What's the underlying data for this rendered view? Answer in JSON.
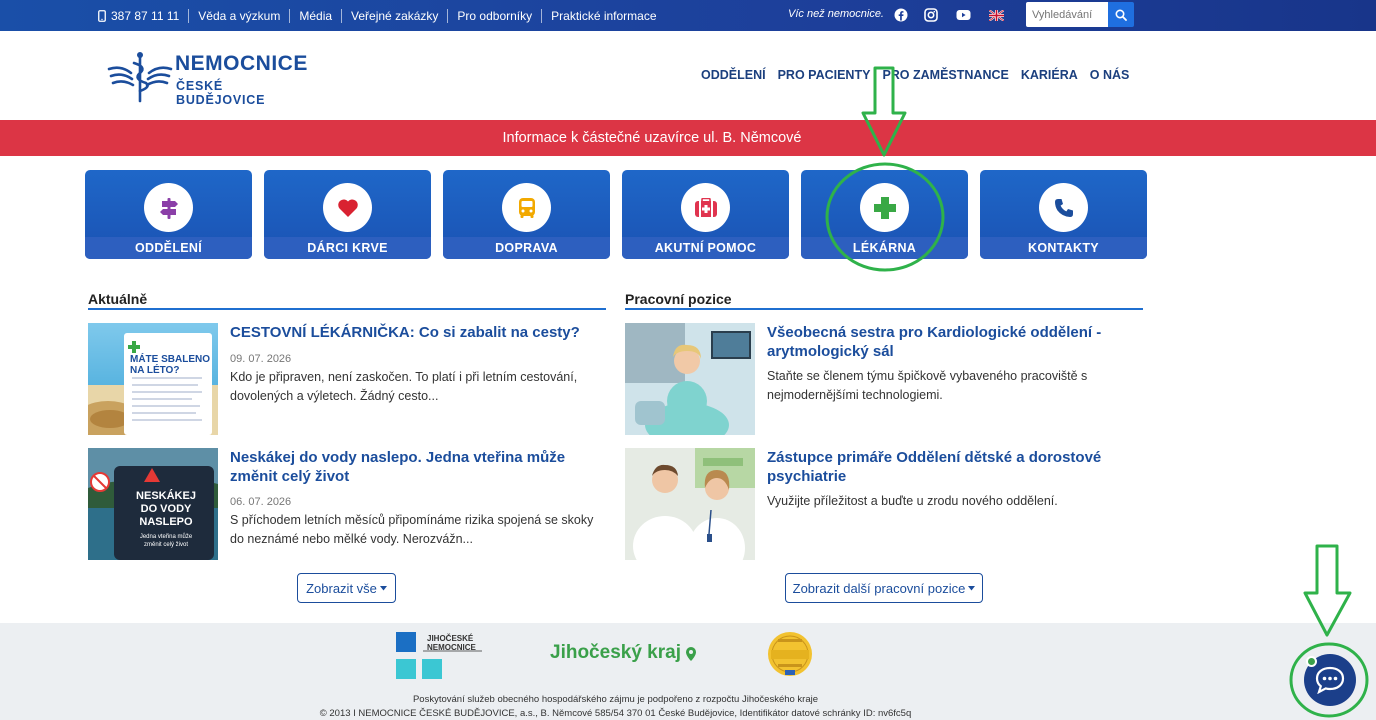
{
  "topbar": {
    "phone": "387 87 11 11",
    "links": [
      "Věda a výzkum",
      "Média",
      "Veřejné zakázky",
      "Pro odborníky",
      "Praktické informace"
    ],
    "tagline": "Víc než nemocnice.",
    "search_placeholder": "Vyhledávání"
  },
  "logo": {
    "line1": "NEMOCNICE",
    "line2": "ČESKÉ BUDĚJOVICE"
  },
  "nav": [
    "ODDĚLENÍ",
    "PRO PACIENTY",
    "PRO ZAMĚSTNANCE",
    "KARIÉRA",
    "O NÁS"
  ],
  "banner": "Informace k částečné uzavírce ul. B. Němcové",
  "tiles": [
    {
      "label": "ODDĚLENÍ",
      "icon": "signpost-icon",
      "color": "#8b3fa8"
    },
    {
      "label": "DÁRCI KRVE",
      "icon": "heart-icon",
      "color": "#d92231"
    },
    {
      "label": "DOPRAVA",
      "icon": "bus-icon",
      "color": "#f2a900"
    },
    {
      "label": "AKUTNÍ POMOC",
      "icon": "first-aid-icon",
      "color": "#e0344f"
    },
    {
      "label": "LÉKÁRNA",
      "icon": "pharmacy-cross-icon",
      "color": "#39a845"
    },
    {
      "label": "KONTAKTY",
      "icon": "phone-icon",
      "color": "#1b4d9c"
    }
  ],
  "news": {
    "title": "Aktuálně",
    "items": [
      {
        "title": "CESTOVNÍ LÉKÁRNIČKA: Co si zabalit na cesty?",
        "date": "09. 07. 2026",
        "text": "Kdo je připraven, není zaskočen. To platí i při letním cestování, dovolených a výletech. Žádný cesto...",
        "thumb_text": [
          "MÁTE SBALENO",
          "NA LÉTO?"
        ]
      },
      {
        "title": "Neskákej do vody naslepo. Jedna vteřina může změnit celý život",
        "date": "06. 07. 2026",
        "text": "S příchodem letních měsíců připomínáme rizika spojená se skoky do neznámé nebo mělké vody. Nerozvážn...",
        "thumb_text": [
          "NESKÁKEJ",
          "DO VODY",
          "NASLEPO",
          "Jedna vteřina může",
          "změnit celý život"
        ]
      }
    ],
    "more_label": "Zobrazit vše"
  },
  "jobs": {
    "title": "Pracovní pozice",
    "items": [
      {
        "title": "Všeobecná sestra pro Kardiologické oddělení - arytmologický sál",
        "text": "Staňte se členem týmu špičkově vybaveného pracoviště s nejmodernějšími technologiemi."
      },
      {
        "title": "Zástupce primáře Oddělení dětské a dorostové psychiatrie",
        "text": "Využijte příležitost a buďte u zrodu nového oddělení."
      }
    ],
    "more_label": "Zobrazit další pracovní pozice"
  },
  "footer": {
    "jn_logo": [
      "JIHOČESKÉ",
      "NEMOCNICE"
    ],
    "region_logo": "Jihočeský kraj",
    "line1": "Poskytování služeb obecného hospodářského zájmu je podpořeno z rozpočtu Jihočeského kraje",
    "line2": "© 2013 I NEMOCNICE ČESKÉ BUDĚJOVICE, a.s., B. Němcové 585/54 370 01 České Budějovice, Identifikátor datové schránky ID: nv6fc5q"
  },
  "colors": {
    "brand": "#1b4d9c",
    "alert": "#dc3545",
    "annotation": "#2fb24a"
  }
}
